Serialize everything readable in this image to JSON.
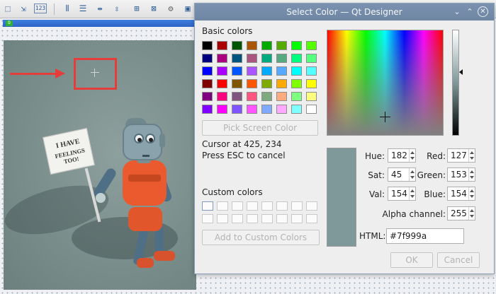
{
  "toolbar": {
    "buttons": [
      {
        "name": "edit-widgets-icon",
        "glyph": "⬚"
      },
      {
        "name": "edit-signals-icon",
        "glyph": "⇲"
      },
      {
        "name": "edit-tab-order-icon",
        "glyph": "123"
      },
      {
        "name": "layout-horizontal-icon",
        "glyph": "⦀"
      },
      {
        "name": "layout-vertical-icon",
        "glyph": "☰"
      },
      {
        "name": "layout-splitter-h-icon",
        "glyph": "⇹"
      },
      {
        "name": "layout-splitter-v-icon",
        "glyph": "⇳"
      },
      {
        "name": "layout-grid-icon",
        "glyph": "⊞"
      },
      {
        "name": "break-layout-icon",
        "glyph": "⊠"
      },
      {
        "name": "adjust-size-icon",
        "glyph": "⚙"
      },
      {
        "name": "form-preview-icon",
        "glyph": "▣"
      }
    ]
  },
  "dialog": {
    "title": "Select Color — Qt Designer",
    "controls": {
      "minimize": "⌄",
      "maximize": "⌃",
      "close": "✕"
    },
    "basic_colors_label": "Basic colors",
    "basic_colors": [
      [
        "#000000",
        "#aa0000",
        "#005500",
        "#aa5500",
        "#00aa00",
        "#55aa00",
        "#00ff00",
        "#55ff00"
      ],
      [
        "#00007f",
        "#aa007f",
        "#00557f",
        "#aa557f",
        "#00aa7f",
        "#55aa7f",
        "#00ff7f",
        "#55ff7f"
      ],
      [
        "#0000ff",
        "#aa00ff",
        "#0055ff",
        "#aa55ff",
        "#00aaff",
        "#55aaff",
        "#00ffff",
        "#55ffff"
      ],
      [
        "#7f0000",
        "#ff0000",
        "#7f5500",
        "#ff5500",
        "#7faa00",
        "#ffaa00",
        "#7fff00",
        "#ffff00"
      ],
      [
        "#7f007f",
        "#ff007f",
        "#7f557f",
        "#ff557f",
        "#7faa7f",
        "#ffaa7f",
        "#7fff7f",
        "#ffff7f"
      ],
      [
        "#7f00ff",
        "#ff00ff",
        "#7f55ff",
        "#ff55ff",
        "#7faaff",
        "#ffaaff",
        "#7fffff",
        "#ffffff"
      ]
    ],
    "pick_screen_color": "Pick Screen Color",
    "cursor_at": "Cursor at 425, 234",
    "press_esc": "Press ESC to cancel",
    "custom_colors_label": "Custom colors",
    "add_to_custom": "Add to Custom Colors",
    "preview_color": "#7f999a",
    "fields": {
      "hue": {
        "label": "Hue:",
        "value": "182"
      },
      "sat": {
        "label": "Sat:",
        "value": "45"
      },
      "val": {
        "label": "Val:",
        "value": "154"
      },
      "red": {
        "label": "Red:",
        "value": "127"
      },
      "green": {
        "label": "Green:",
        "value": "153"
      },
      "blue": {
        "label": "Blue:",
        "value": "154"
      },
      "alpha": {
        "label": "Alpha channel:",
        "value": "255"
      }
    },
    "html_label": "HTML:",
    "html_value": "#7f999a",
    "ok_label": "OK",
    "cancel_label": "Cancel"
  },
  "canvas": {
    "sign_line1": "I HAVE",
    "sign_line2": "FEELINGS TOO!",
    "annotation_color": "#e53d3a"
  },
  "form": {
    "icon_label": "D"
  }
}
